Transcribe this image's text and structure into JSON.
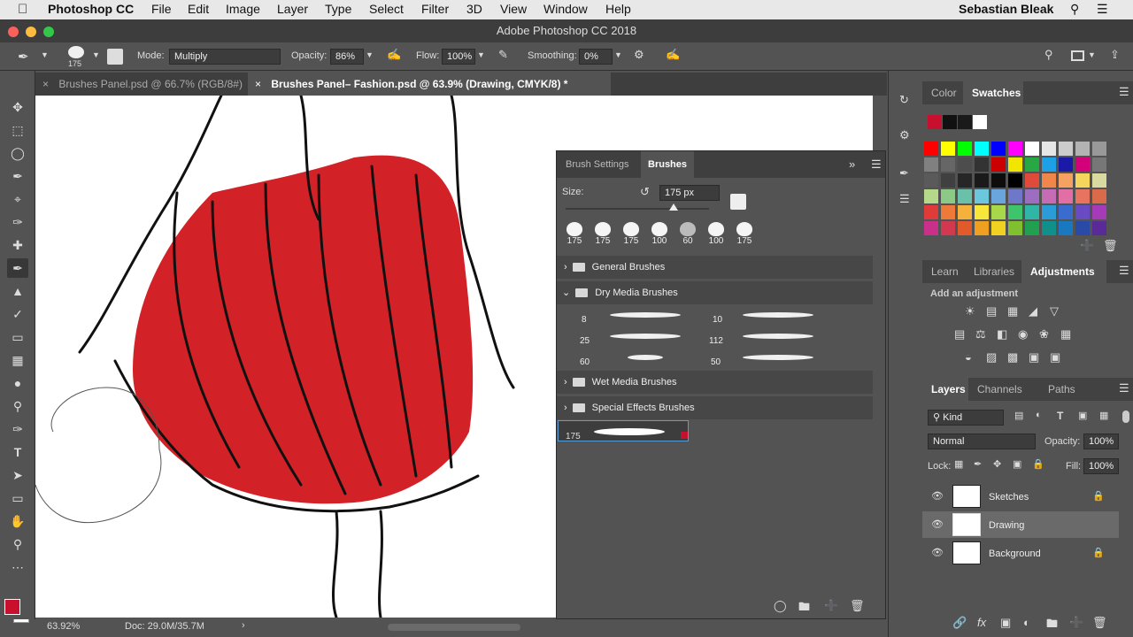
{
  "menubar": {
    "apple": "",
    "app": "Photoshop CC",
    "items": [
      "File",
      "Edit",
      "Image",
      "Layer",
      "Type",
      "Select",
      "Filter",
      "3D",
      "View",
      "Window",
      "Help"
    ],
    "user": "Sebastian Bleak"
  },
  "window": {
    "title": "Adobe Photoshop CC 2018"
  },
  "options": {
    "brush_size": "175",
    "mode_label": "Mode:",
    "mode_value": "Multiply",
    "opacity_label": "Opacity:",
    "opacity_value": "86%",
    "flow_label": "Flow:",
    "flow_value": "100%",
    "smoothing_label": "Smoothing:",
    "smoothing_value": "0%"
  },
  "doc_tabs": [
    {
      "label": "Brushes Panel.psd @ 66.7% (RGB/8#)"
    },
    {
      "label": "Brushes Panel– Fashion.psd @ 63.9% (Drawing, CMYK/8) *"
    }
  ],
  "status": {
    "zoom": "63.92%",
    "doc": "Doc: 29.0M/35.7M"
  },
  "brushes_panel": {
    "tabs": [
      "Brush Settings",
      "Brushes"
    ],
    "size_label": "Size:",
    "size_value": "175 px",
    "size_fraction": 0.75,
    "recent_sizes": [
      "175",
      "175",
      "175",
      "100",
      "60",
      "100",
      "175"
    ],
    "groups": [
      "General Brushes",
      "Dry Media Brushes",
      "Wet Media Brushes",
      "Special Effects Brushes"
    ],
    "dry_media": [
      {
        "size": "8"
      },
      {
        "size": "10"
      },
      {
        "size": "25"
      },
      {
        "size": "112"
      },
      {
        "size": "60"
      },
      {
        "size": "50"
      }
    ],
    "selected_brush_size": "175"
  },
  "color_panel": {
    "tabs": [
      "Color",
      "Swatches"
    ],
    "recent": [
      "#c8102e",
      "#111111",
      "#1a1a1a",
      "#ffffff"
    ],
    "swatches": [
      [
        "#ff0000",
        "#ffff00",
        "#00ff00",
        "#00ffff",
        "#0000ff",
        "#ff00ff",
        "#ffffff",
        "#e6e6e6",
        "#cccccc",
        "#b3b3b3",
        "#999999"
      ],
      [
        "#808080",
        "#666666",
        "#4d4d4d",
        "#333333",
        "#cc0000",
        "#f2e600",
        "#28a745",
        "#1ea0e6",
        "#1a1aa6",
        "#d4007a",
        "#777777"
      ],
      [
        "#5a5a5a",
        "#404040",
        "#262626",
        "#1a1a1a",
        "#0d0d0d",
        "#000000",
        "#e04a3a",
        "#f0864a",
        "#f4a261",
        "#f6d55c",
        "#d9d9a0"
      ],
      [
        "#b5d88a",
        "#8cc987",
        "#6ac0a8",
        "#6cc7dd",
        "#6aa6dd",
        "#6f77c8",
        "#9c6dc0",
        "#c56cb4",
        "#e26ea6",
        "#e8735e",
        "#d96b4a"
      ],
      [
        "#e03b3b",
        "#ee7a3a",
        "#f6b13c",
        "#f8e63a",
        "#a8d84a",
        "#3ec46a",
        "#2fb6a6",
        "#2a9cd8",
        "#3a6cd0",
        "#6a4ac2",
        "#a73ab8"
      ],
      [
        "#c8308a",
        "#d23850",
        "#e05a2a",
        "#f0a020",
        "#f0d020",
        "#80c030",
        "#20a050",
        "#10908a",
        "#1a78c0",
        "#2a4aa8",
        "#5a2a98"
      ]
    ]
  },
  "adjustments_panel": {
    "tabs": [
      "Learn",
      "Libraries",
      "Adjustments"
    ],
    "hint": "Add an adjustment"
  },
  "layers_panel": {
    "tabs": [
      "Layers",
      "Channels",
      "Paths"
    ],
    "filter": "Kind",
    "blend": "Normal",
    "opacity_label": "Opacity:",
    "opacity_value": "100%",
    "lock_label": "Lock:",
    "fill_label": "Fill:",
    "fill_value": "100%",
    "layers": [
      {
        "name": "Sketches"
      },
      {
        "name": "Drawing"
      },
      {
        "name": "Background"
      }
    ]
  }
}
